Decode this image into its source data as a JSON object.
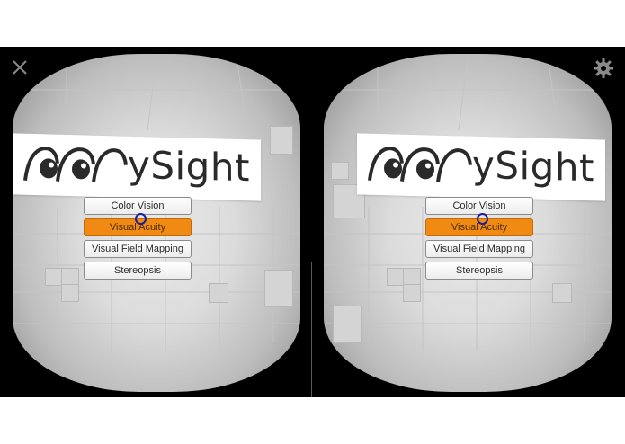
{
  "app": {
    "logo_text": "ySight"
  },
  "menu": {
    "items": [
      {
        "label": "Color Vision",
        "active": false
      },
      {
        "label": "Visual Acuity",
        "active": true
      },
      {
        "label": "Visual Field Mapping",
        "active": false
      },
      {
        "label": "Stereopsis",
        "active": false
      }
    ]
  },
  "icons": {
    "close": "close-icon",
    "settings": "gear-icon"
  },
  "colors": {
    "active_button": "#f08a12",
    "reticle": "#1a1f9a",
    "frame": "#000000"
  }
}
